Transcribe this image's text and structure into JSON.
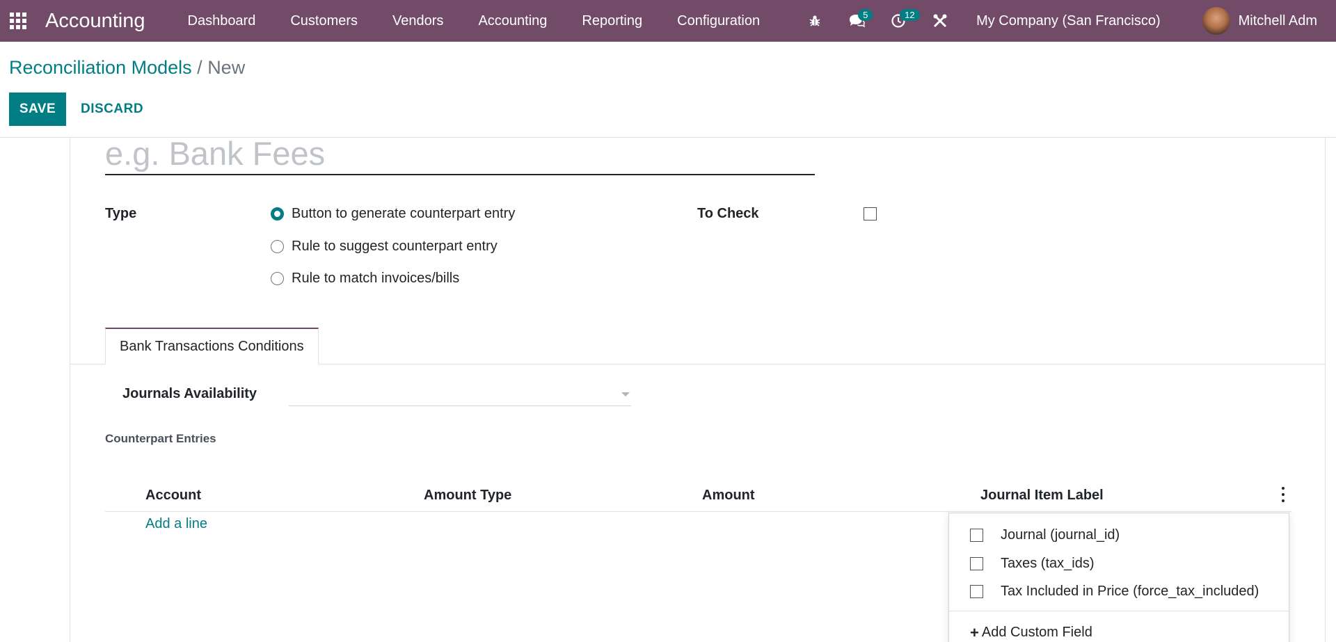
{
  "navbar": {
    "app_title": "Accounting",
    "menu": [
      "Dashboard",
      "Customers",
      "Vendors",
      "Accounting",
      "Reporting",
      "Configuration"
    ],
    "messages_count": "5",
    "activities_count": "12",
    "company": "My Company (San Francisco)",
    "user": "Mitchell Adm"
  },
  "breadcrumb": {
    "parent": "Reconciliation Models",
    "separator": "/",
    "current": "New"
  },
  "actions": {
    "save": "SAVE",
    "discard": "DISCARD"
  },
  "form": {
    "name_placeholder": "e.g. Bank Fees",
    "name_value": "",
    "type_label": "Type",
    "type_options": [
      {
        "label": "Button to generate counterpart entry",
        "checked": true
      },
      {
        "label": "Rule to suggest counterpart entry",
        "checked": false
      },
      {
        "label": "Rule to match invoices/bills",
        "checked": false
      }
    ],
    "to_check_label": "To Check",
    "to_check_value": false
  },
  "tabs": [
    {
      "label": "Bank Transactions Conditions",
      "active": true
    }
  ],
  "conditions": {
    "journals_label": "Journals Availability",
    "journals_value": ""
  },
  "counterpart": {
    "section_label": "Counterpart Entries",
    "columns": [
      "Account",
      "Amount Type",
      "Amount",
      "Journal Item Label"
    ],
    "add_line": "Add a line"
  },
  "optional_columns": {
    "items": [
      {
        "label": "Journal (journal_id)",
        "checked": false
      },
      {
        "label": "Taxes (tax_ids)",
        "checked": false
      },
      {
        "label": "Tax Included in Price (force_tax_included)",
        "checked": false
      }
    ],
    "add_custom_field": "Add Custom Field"
  },
  "colors": {
    "navbar": "#714b67",
    "primary": "#017e84"
  },
  "icons": [
    "apps-grid-icon",
    "bug-icon",
    "chat-icon",
    "clock-icon",
    "tools-icon",
    "chevron-down-icon",
    "kebab-icon",
    "plus-icon"
  ]
}
